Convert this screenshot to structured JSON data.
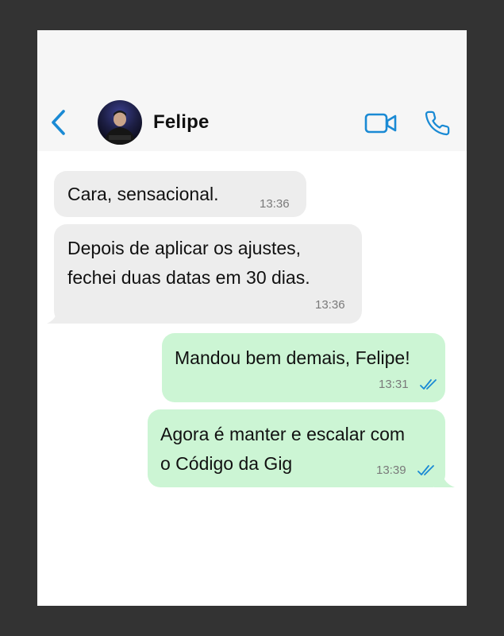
{
  "header": {
    "contact_name": "Felipe",
    "back_icon": "chevron-left-icon",
    "video_icon": "video-camera-icon",
    "call_icon": "phone-icon",
    "accent_color": "#1a8ad4",
    "avatar": "profile-photo"
  },
  "messages": [
    {
      "direction": "incoming",
      "lines": [
        "Cara, sensacional."
      ],
      "time": "13:36"
    },
    {
      "direction": "incoming",
      "lines": [
        "Depois de aplicar os ajustes,",
        "fechei duas datas em 30 dias."
      ],
      "time": "13:36"
    },
    {
      "direction": "outgoing",
      "lines": [
        "Mandou bem demais, Felipe!"
      ],
      "time": "13:31",
      "status": "read"
    },
    {
      "direction": "outgoing",
      "lines": [
        "Agora é manter e escalar com",
        "o Código da Gig"
      ],
      "time": "13:39",
      "status": "read"
    }
  ],
  "colors": {
    "incoming_bubble": "#ededed",
    "outgoing_bubble": "#ccf5d4",
    "read_ticks": "#1a8ad4",
    "header_bg": "#f6f6f6",
    "frame_bg": "#333333"
  }
}
